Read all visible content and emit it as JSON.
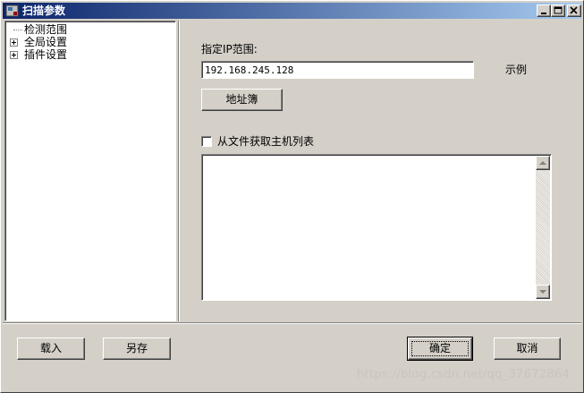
{
  "window": {
    "title": "扫描参数"
  },
  "title_buttons": {
    "minimize_icon": "minimize-icon",
    "maximize_icon": "maximize-icon",
    "close_icon": "close-icon"
  },
  "tree": {
    "items": [
      {
        "label": "检测范围",
        "expandable": false
      },
      {
        "label": "全局设置",
        "expandable": true
      },
      {
        "label": "插件设置",
        "expandable": true
      }
    ]
  },
  "main": {
    "ip_label": "指定IP范围:",
    "ip_value": "192.168.245.128",
    "example_label": "示例",
    "address_book_button": "地址簿",
    "file_checkbox_label": "从文件获取主机列表",
    "file_checkbox_checked": false,
    "host_list_value": ""
  },
  "footer": {
    "load_button": "载入",
    "save_as_button": "另存",
    "ok_button": "确定",
    "cancel_button": "取消"
  },
  "watermark": "https://blog.csdn.net/qq_37672864",
  "colors": {
    "face": "#d4d0c8",
    "title_start": "#0a246a",
    "title_end": "#a6caf0"
  }
}
